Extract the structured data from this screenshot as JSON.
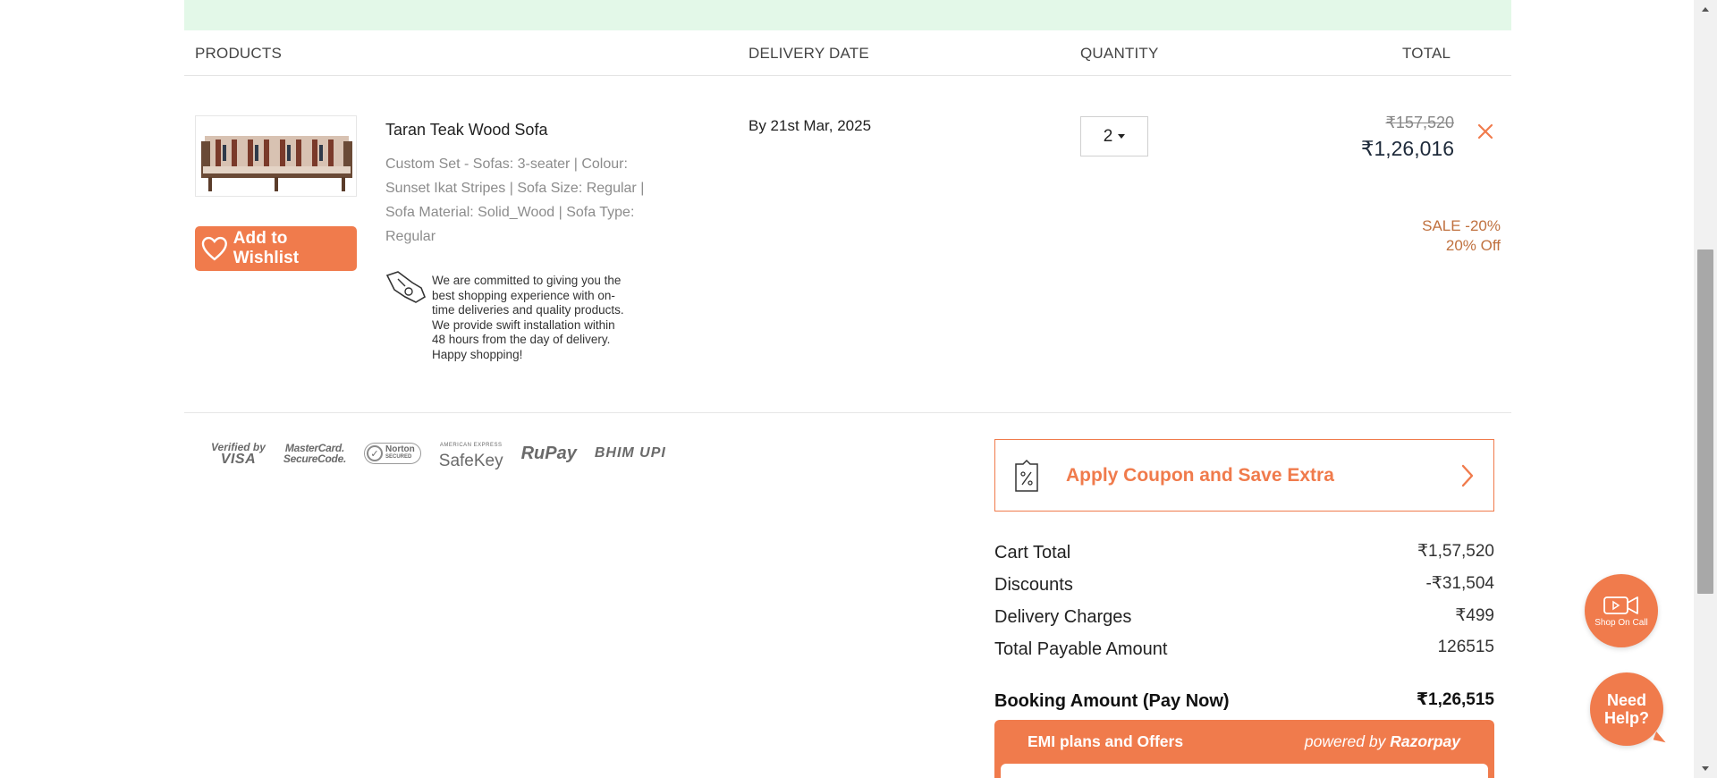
{
  "table_header": {
    "products": "PRODUCTS",
    "delivery_date": "DELIVERY DATE",
    "quantity": "QUANTITY",
    "total": "TOTAL"
  },
  "item": {
    "name": "Taran Teak Wood Sofa",
    "description": "Custom Set - Sofas: 3-seater | Colour: Sunset Ikat Stripes | Sofa Size: Regular | Sofa Material: Solid_Wood | Sofa Type: Regular",
    "wishlist_label": "Add to Wishlist",
    "promise_text": "We are committed to giving you the best shopping experience with on-time deliveries and quality products. We provide swift installation within 48 hours from the day of delivery. Happy shopping!",
    "delivery_date": "By 21st Mar, 2025",
    "quantity": "2",
    "price_original": "₹157,520",
    "price_final": "₹1,26,016",
    "sale_label": "SALE -20%",
    "off_label": "20% Off",
    "remove_icon": "close-icon"
  },
  "payment_logos": {
    "visa_top": "Verified by",
    "visa_bottom": "VISA",
    "mc_top": "MasterCard.",
    "mc_bottom": "SecureCode.",
    "norton": "Norton",
    "norton_sub": "SECURED",
    "safekey_top": "AMERICAN EXPRESS",
    "safekey": "SafeKey",
    "rupay": "RuPay",
    "bhim": "BHIM UPI"
  },
  "coupon": {
    "label": "Apply Coupon and Save Extra"
  },
  "summary": {
    "cart_total_label": "Cart Total",
    "cart_total_value": "₹1,57,520",
    "discounts_label": "Discounts",
    "discounts_value": "-₹31,504",
    "delivery_label": "Delivery Charges",
    "delivery_value": "₹499",
    "payable_label": "Total Payable Amount",
    "payable_value": "126515",
    "booking_label": "Booking Amount (Pay Now)",
    "booking_value": "₹1,26,515"
  },
  "emi": {
    "title": "EMI plans and Offers",
    "powered_prefix": "powered by",
    "powered_brand": "Razorpay"
  },
  "floating": {
    "shop_on_call": "Shop On Call",
    "need_help": "Need Help?"
  },
  "colors": {
    "accent": "#f07b4c",
    "banner": "#e3f8e8",
    "sale_text": "#c0713f"
  }
}
